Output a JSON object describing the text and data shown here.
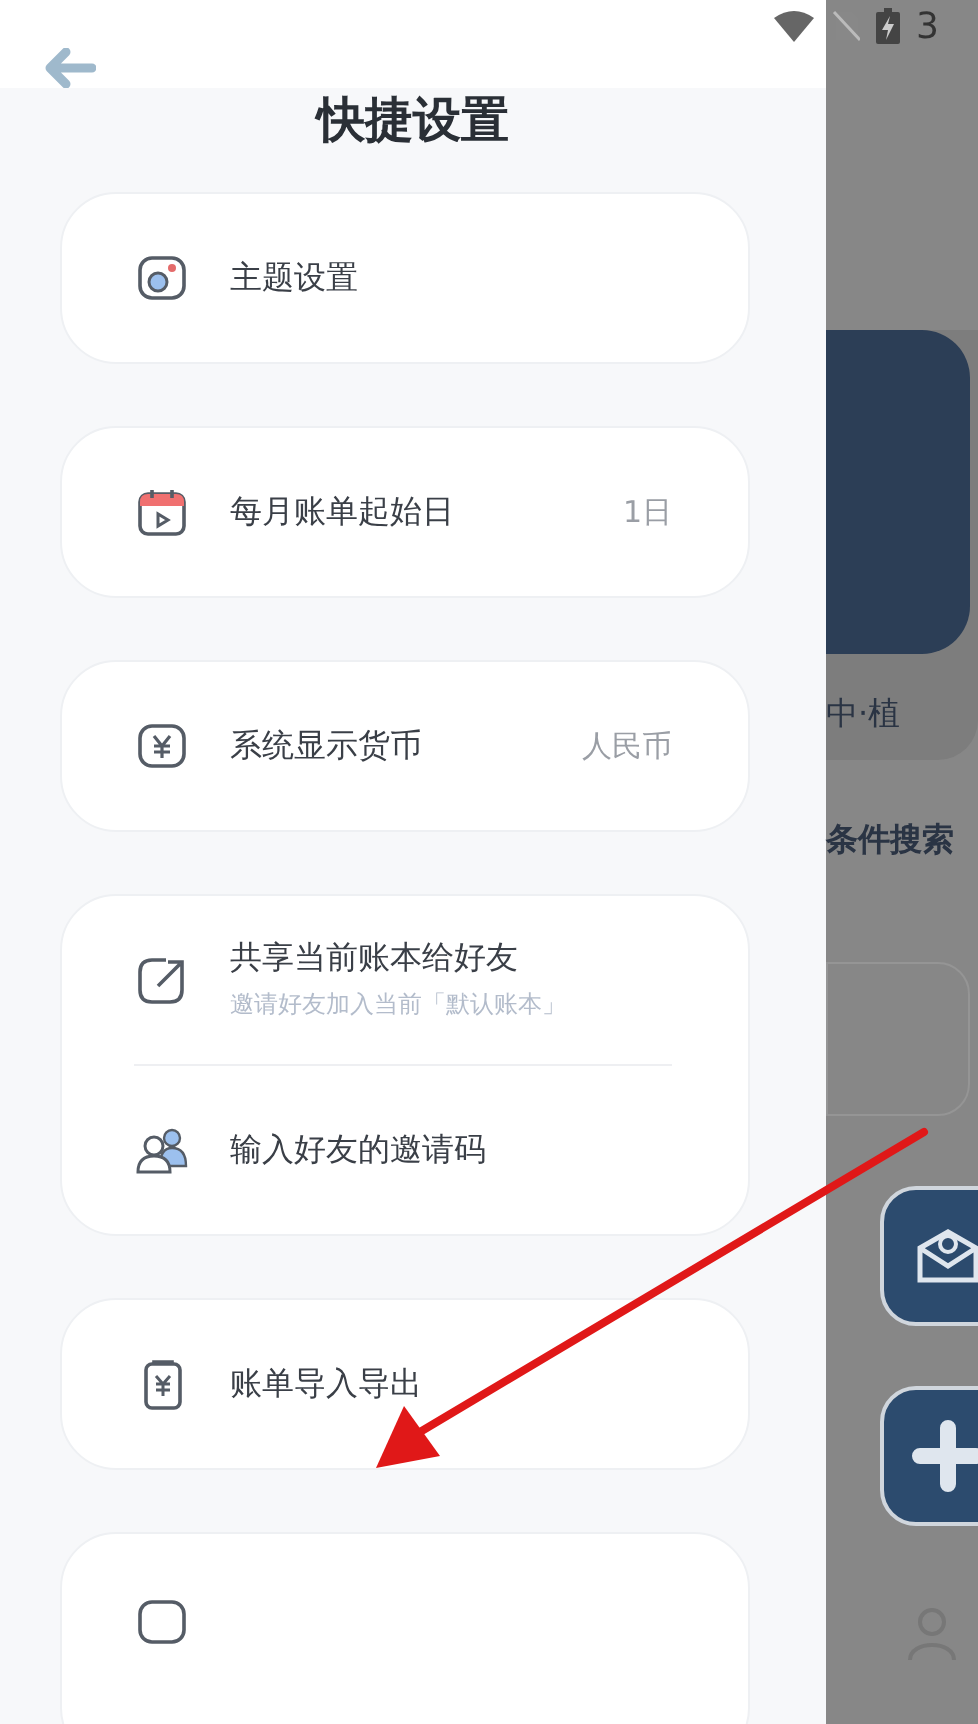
{
  "status_bar": {
    "text": "3"
  },
  "header": {
    "title": "快捷设置"
  },
  "cards": [
    {
      "items": [
        {
          "kind": "theme",
          "label": "主题设置"
        }
      ]
    },
    {
      "items": [
        {
          "kind": "calendar",
          "label": "每月账单起始日",
          "value": "1日"
        }
      ]
    },
    {
      "items": [
        {
          "kind": "currency",
          "label": "系统显示货币",
          "value": "人民币"
        }
      ]
    },
    {
      "items": [
        {
          "kind": "share",
          "label": "共享当前账本给好友",
          "subtitle": "邀请好友加入当前「默认账本」"
        },
        {
          "kind": "friends",
          "label": "输入好友的邀请码"
        }
      ]
    },
    {
      "items": [
        {
          "kind": "import",
          "label": "账单导入导出"
        }
      ]
    },
    {
      "items": [
        {
          "kind": "more"
        }
      ]
    }
  ],
  "background_screen": {
    "card_caption": "中·植",
    "search_label": "条件搜索"
  }
}
